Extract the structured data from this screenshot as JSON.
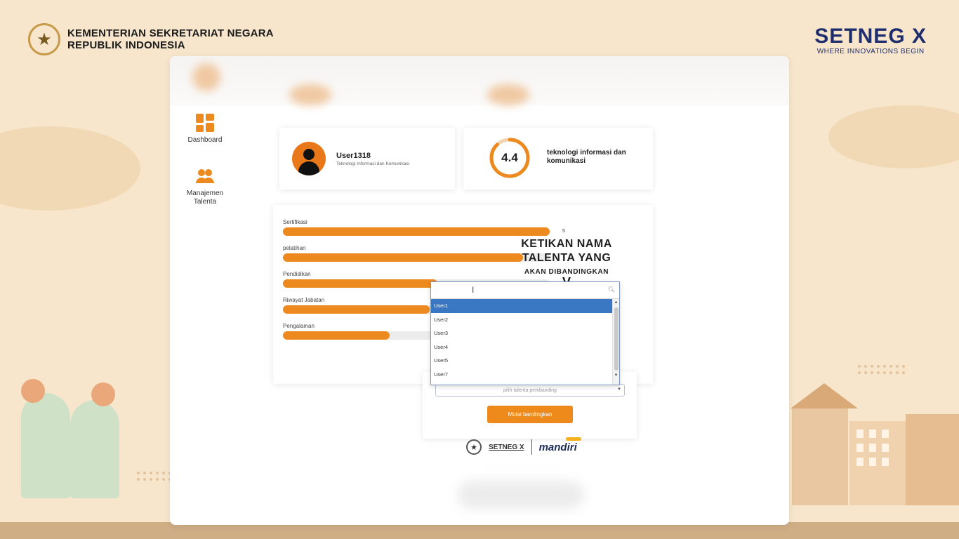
{
  "header": {
    "ministry_line1": "KEMENTERIAN SEKRETARIAT NEGARA",
    "ministry_line2": "REPUBLIK INDONESIA",
    "brand_title": "SETNEG X",
    "brand_tagline": "WHERE INNOVATIONS BEGIN"
  },
  "sidebar": {
    "items": [
      {
        "label": "Dashboard",
        "icon": "dashboard-icon"
      },
      {
        "label": "Manajemen Talenta",
        "icon": "people-icon"
      }
    ]
  },
  "profile": {
    "username": "User1318",
    "subtitle": "Teknologi Informasi dan Komunikasi"
  },
  "score": {
    "value": "4.4",
    "label": "teknologi informasi dan komunikasi",
    "fill_fraction": 0.88
  },
  "skills": {
    "items": [
      {
        "label": "Sertifikasi",
        "fraction": 1.0,
        "value": "5"
      },
      {
        "label": "pelatihan",
        "fraction": 0.9,
        "value": ""
      },
      {
        "label": "Pendidikan",
        "fraction": 0.58,
        "value": ""
      },
      {
        "label": "Riwayat Jabatan",
        "fraction": 0.55,
        "value": ""
      },
      {
        "label": "Pengalaman",
        "fraction": 0.4,
        "value": ""
      }
    ]
  },
  "instruction": {
    "line1": "KETIKAN NAMA",
    "line2": "TALENTA YANG",
    "line3": "AKAN DIBANDINGKAN",
    "arrow": "V"
  },
  "compare": {
    "select_placeholder": "pilih talenta pembanding",
    "button_label": "Mulai bandingkan"
  },
  "dropdown": {
    "search_value": "",
    "options": [
      "User1",
      "User2",
      "User3",
      "User4",
      "User5",
      "User7"
    ],
    "selected_index": 0
  },
  "footer": {
    "setneg_label": "SETNEG X",
    "partner_label": "mandiri"
  },
  "colors": {
    "accent": "#ec8a1f",
    "brand_blue": "#1f2f6e",
    "selection_blue": "#3a78c4"
  }
}
